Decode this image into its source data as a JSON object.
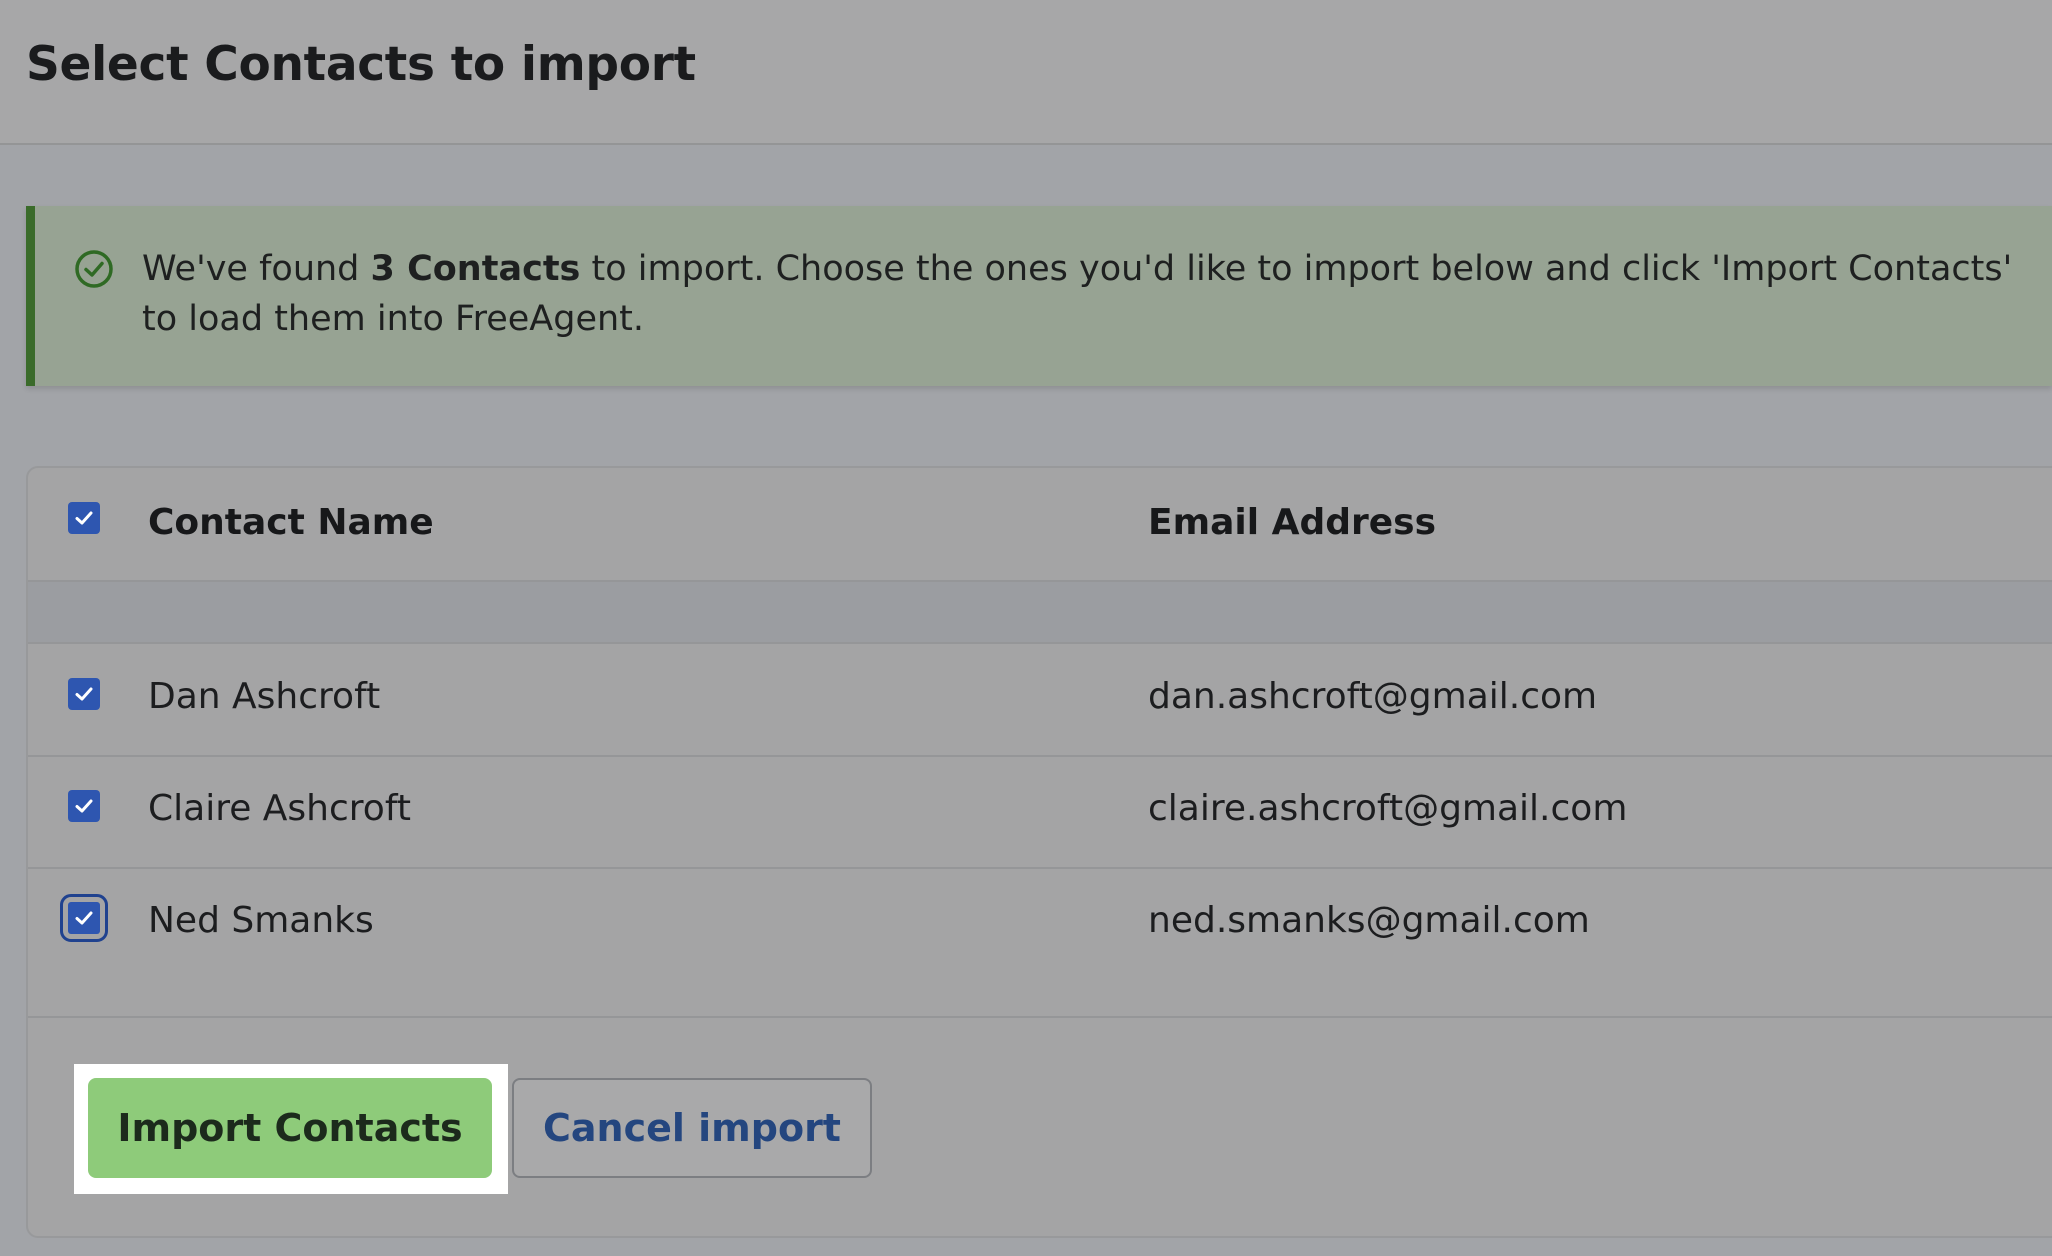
{
  "page": {
    "title": "Select Contacts to import"
  },
  "notice": {
    "icon": "check-circle-icon",
    "text_prefix": "We've found ",
    "count_text": "3 Contacts",
    "text_suffix": " to import. Choose the ones you'd like to import below and click 'Import Contacts' to load them into FreeAgent.",
    "accent_color": "#3a6b2a"
  },
  "table": {
    "select_all_checked": true,
    "columns": [
      "Contact Name",
      "Email Address"
    ],
    "rows": [
      {
        "name": "Dan Ashcroft",
        "email": "dan.ashcroft@gmail.com",
        "checked": true
      },
      {
        "name": "Claire Ashcroft",
        "email": "claire.ashcroft@gmail.com",
        "checked": true
      },
      {
        "name": "Ned Smanks",
        "email": "ned.smanks@gmail.com",
        "checked": true
      }
    ]
  },
  "actions": {
    "import_label": "Import Contacts",
    "cancel_label": "Cancel import",
    "import_color": "#8ecb7a",
    "cancel_text_color": "#24467f"
  },
  "colors": {
    "checkbox": "#2e56b0"
  }
}
